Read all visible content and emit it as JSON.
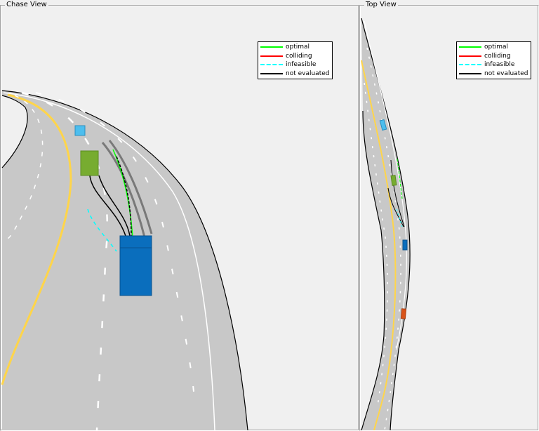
{
  "chase_view": {
    "title": "Chase View",
    "legend": [
      {
        "label": "optimal",
        "color": "#00ff00",
        "style": "solid"
      },
      {
        "label": "colliding",
        "color": "#ff0000",
        "style": "solid"
      },
      {
        "label": "infeasible",
        "color": "#00ffff",
        "style": "dashed"
      },
      {
        "label": "not evaluated",
        "color": "#000000",
        "style": "solid"
      }
    ]
  },
  "top_view": {
    "title": "Top View",
    "legend": [
      {
        "label": "optimal",
        "color": "#00ff00",
        "style": "solid"
      },
      {
        "label": "colliding",
        "color": "#ff0000",
        "style": "solid"
      },
      {
        "label": "infeasible",
        "color": "#00ffff",
        "style": "dashed"
      },
      {
        "label": "not evaluated",
        "color": "#000000",
        "style": "solid"
      }
    ]
  },
  "colors": {
    "road": "#c8c8c8",
    "lane_center": "#ffd54a",
    "ego_vehicle": "#0a6ebd",
    "lead_vehicle": "#77ac30",
    "far_vehicle": "#4dbeee",
    "rear_vehicle": "#d95319"
  }
}
